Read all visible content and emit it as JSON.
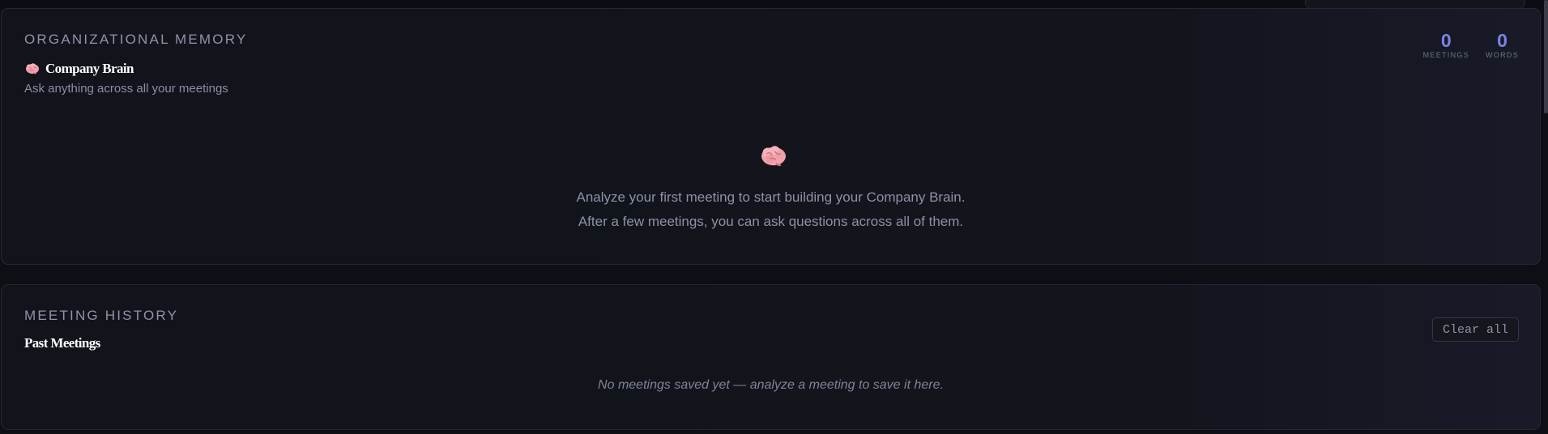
{
  "memory": {
    "eyebrow": "ORGANIZATIONAL MEMORY",
    "title": "Company Brain",
    "title_icon": "brain-icon",
    "subtitle": "Ask anything across all your meetings",
    "stats": [
      {
        "value": "0",
        "label": "MEETINGS"
      },
      {
        "value": "0",
        "label": "WORDS"
      }
    ],
    "empty_icon": "brain-icon",
    "empty_line1": "Analyze your first meeting to start building your Company Brain.",
    "empty_line2": "After a few meetings, you can ask questions across all of them."
  },
  "history": {
    "eyebrow": "MEETING HISTORY",
    "title": "Past Meetings",
    "clear_label": "Clear all",
    "empty_text": "No meetings saved yet — analyze a meeting to save it here."
  },
  "colors": {
    "background": "#0e0f15",
    "card": "#13141c",
    "accent": "#7b83e6",
    "brain": "#f2a3ab"
  }
}
